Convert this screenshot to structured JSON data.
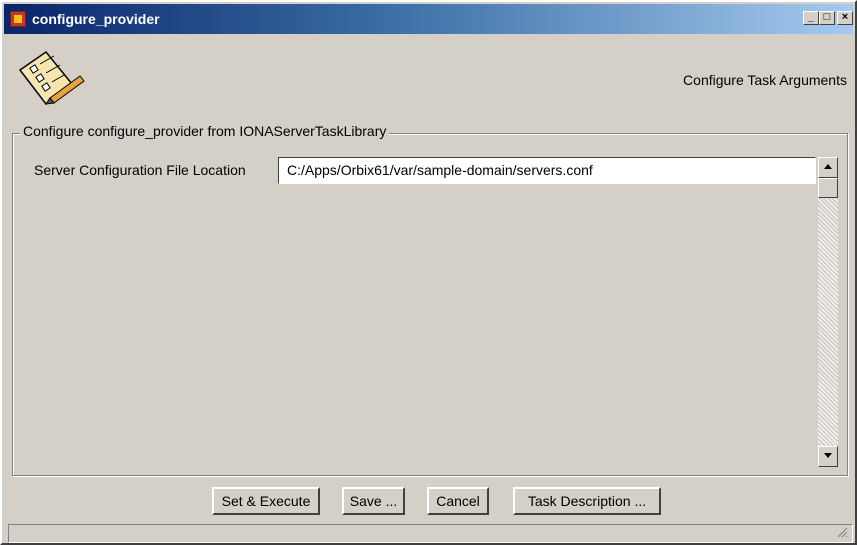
{
  "window": {
    "title": "configure_provider",
    "controls": {
      "minimize": "_",
      "maximize": "□",
      "close": "×"
    }
  },
  "header": {
    "title": "Configure Task Arguments",
    "icon": "checklist-pencil-icon"
  },
  "group": {
    "legend": "Configure configure_provider from IONAServerTaskLibrary"
  },
  "field": {
    "label": "Server Configuration File Location",
    "value": "C:/Apps/Orbix61/var/sample-domain/servers.conf"
  },
  "buttons": {
    "set_execute": "Set & Execute",
    "save": "Save ...",
    "cancel": "Cancel",
    "task_description": "Task Description ..."
  },
  "colors": {
    "face": "#d4d0c8",
    "titlebar_start": "#0a246a",
    "titlebar_end": "#a6caf0"
  }
}
